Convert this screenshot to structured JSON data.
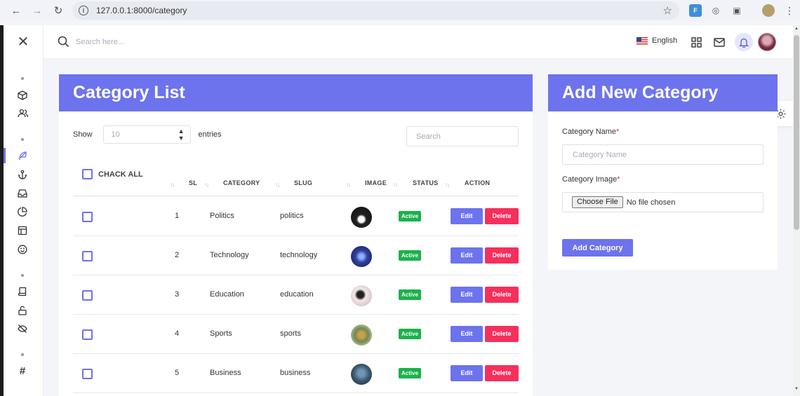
{
  "browser": {
    "url": "127.0.0.1:8000/category"
  },
  "header": {
    "search_placeholder": "Search here...",
    "language": "English"
  },
  "list": {
    "title": "Category List",
    "show_label": "Show",
    "page_length": "10",
    "entries_label": "entries",
    "search_placeholder": "Search",
    "check_all_label": "CHACK ALL",
    "columns": {
      "sl": "SL",
      "category": "CATEGORY",
      "slug": "SLUG",
      "image": "IMAGE",
      "status": "STATUS",
      "action": "ACTION"
    },
    "rows": [
      {
        "sl": "1",
        "category": "Politics",
        "slug": "politics",
        "status": "Active",
        "edit": "Edit",
        "delete": "Delete"
      },
      {
        "sl": "2",
        "category": "Technology",
        "slug": "technology",
        "status": "Active",
        "edit": "Edit",
        "delete": "Delete"
      },
      {
        "sl": "3",
        "category": "Education",
        "slug": "education",
        "status": "Active",
        "edit": "Edit",
        "delete": "Delete"
      },
      {
        "sl": "4",
        "category": "Sports",
        "slug": "sports",
        "status": "Active",
        "edit": "Edit",
        "delete": "Delete"
      },
      {
        "sl": "5",
        "category": "Business",
        "slug": "business",
        "status": "Active",
        "edit": "Edit",
        "delete": "Delete"
      }
    ]
  },
  "form": {
    "title": "Add New Category",
    "name_label": "Category Name",
    "name_placeholder": "Category Name",
    "image_label": "Category Image",
    "required_mark": "*",
    "choose_file": "Choose File",
    "file_status": "No file chosen",
    "submit_label": "Add Category"
  },
  "colors": {
    "accent": "#6c73ed",
    "danger": "#f62f5d",
    "success": "#1bb24a"
  }
}
